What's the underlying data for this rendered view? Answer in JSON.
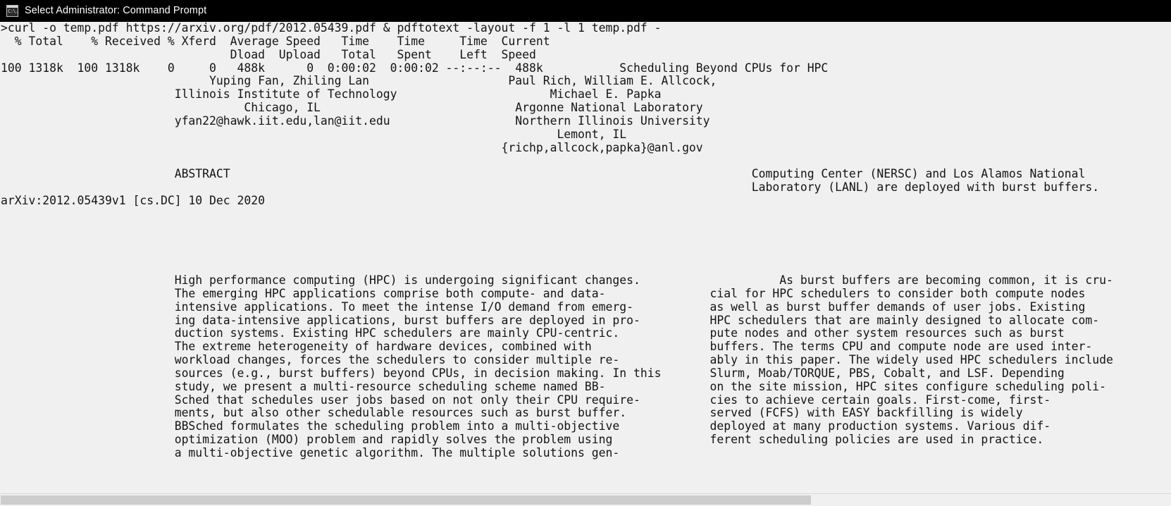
{
  "window": {
    "title": "Select Administrator: Command Prompt",
    "icon": "command-prompt-icon",
    "icon_glyph": "C:\\.",
    "titlebar_bg": "#000000",
    "console_bg": "#f0f0f0",
    "console_fg": "#141414"
  },
  "console": {
    "prompt_line": ">curl -o temp.pdf https://arxiv.org/pdf/2012.05439.pdf & pdftotext -layout -f 1 -l 1 temp.pdf -",
    "curl_progress": {
      "header_line_1": "  % Total    % Received % Xferd  Average Speed   Time    Time     Time  Current",
      "header_line_2": "                                 Dload  Upload   Total   Spent    Left  Speed",
      "data_line": "100 1318k  100 1318k    0     0   488k      0  0:00:02  0:00:02 --:--:--  488k"
    },
    "lines": [
      ">curl -o temp.pdf https://arxiv.org/pdf/2012.05439.pdf & pdftotext -layout -f 1 -l 1 temp.pdf -",
      "  % Total    % Received % Xferd  Average Speed   Time    Time     Time  Current",
      "                                 Dload  Upload   Total   Spent    Left  Speed",
      "100 1318k  100 1318k    0     0   488k      0  0:00:02  0:00:02 --:--:--  488k           Scheduling Beyond CPUs for HPC",
      "                              Yuping Fan, Zhiling Lan                    Paul Rich, William E. Allcock,",
      "                         Illinois Institute of Technology                      Michael E. Papka",
      "                                   Chicago, IL                            Argonne National Laboratory",
      "                         yfan22@hawk.iit.edu,lan@iit.edu                  Northern Illinois University",
      "                                                                                Lemont, IL",
      "                                                                        {richp,allcock,papka}@anl.gov",
      "",
      "                         ABSTRACT                                                                           Computing Center (NERSC) and Los Alamos National",
      "                                                                                                            Laboratory (LANL) are deployed with burst buffers.",
      "arXiv:2012.05439v1 [cs.DC] 10 Dec 2020",
      "",
      "",
      "",
      "",
      "",
      "                         High performance computing (HPC) is undergoing significant changes.                    As burst buffers are becoming common, it is cru-",
      "                         The emerging HPC applications comprise both compute- and data-               cial for HPC schedulers to consider both compute nodes",
      "                         intensive applications. To meet the intense I/O demand from emerg-           as well as burst buffer demands of user jobs. Existing",
      "                         ing data-intensive applications, burst buffers are deployed in pro-          HPC schedulers that are mainly designed to allocate com-",
      "                         duction systems. Existing HPC schedulers are mainly CPU-centric.             pute nodes and other system resources such as burst",
      "                         The extreme heterogeneity of hardware devices, combined with                 buffers. The terms CPU and compute node are used inter-",
      "                         workload changes, forces the schedulers to consider multiple re-             ably in this paper. The widely used HPC schedulers include",
      "                         sources (e.g., burst buffers) beyond CPUs, in decision making. In this       Slurm, Moab/TORQUE, PBS, Cobalt, and LSF. Depending",
      "                         study, we present a multi-resource scheduling scheme named BB-               on the site mission, HPC sites configure scheduling poli-",
      "                         Sched that schedules user jobs based on not only their CPU require-          cies to achieve certain goals. First-come, first-",
      "                         ments, but also other schedulable resources such as burst buffer.            served (FCFS) with EASY backfilling is widely",
      "                         BBSched formulates the scheduling problem into a multi-objective             deployed at many production systems. Various dif-",
      "                         optimization (MOO) problem and rapidly solves the problem using              ferent scheduling policies are used in practice.",
      "                         a multi-objective genetic algorithm. The multiple solutions gen-"
    ],
    "paper": {
      "title": "Scheduling Beyond CPUs for HPC",
      "authors_left": "Yuping Fan, Zhiling Lan",
      "affiliation_left_1": "Illinois Institute of Technology",
      "affiliation_left_2": "Chicago, IL",
      "email_left": "yfan22@hawk.iit.edu,lan@iit.edu",
      "authors_right_1": "Paul Rich, William E. Allcock,",
      "authors_right_2": "Michael E. Papka",
      "affiliation_right_1": "Argonne National Laboratory",
      "affiliation_right_2": "Northern Illinois University",
      "affiliation_right_3": "Lemont, IL",
      "email_right": "{richp,allcock,papka}@anl.gov",
      "abstract_heading": "ABSTRACT",
      "arxiv_stamp": "arXiv:2012.05439v1 [cs.DC] 10 Dec 2020"
    }
  },
  "scrollbar": {
    "horizontal_thumb_label": "horizontal-scroll-thumb",
    "left_arrow": "◄",
    "right_arrow": "►"
  }
}
